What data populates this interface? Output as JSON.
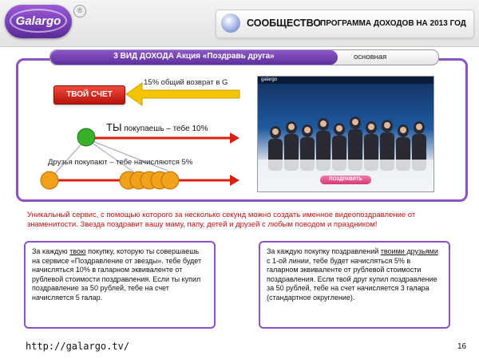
{
  "header": {
    "logo_text": "Galargo",
    "logo_mark": "®",
    "title_main": "СООБЩЕСТВО",
    "title_sub": "ПРОГРАММА ДОХОДОВ НА 2013 ГОД"
  },
  "banner": {
    "title": "3 ВИД ДОХОДА  Акция «Поздравь  друга»",
    "note": "основная"
  },
  "diagram": {
    "account_label": "ТВОЙ СЧЕТ",
    "return_label": "15% общий возврат  в G",
    "you_big": "ТЫ",
    "you_rest": " покупаешь – тебе 10%",
    "friends_label": "Друзья покупают – тебе начисляются 5%",
    "colors": {
      "arrow_red": "#d81f12",
      "arrow_yellow": "#f4c400",
      "dot_green": "#3ab02a",
      "dot_orange": "#f2a21a"
    }
  },
  "video": {
    "site_logo": "galargo",
    "button_label": "ПОЗДРАВИТЬ"
  },
  "red_paragraph": "Уникальный сервис, с помощью которого за несколько секунд можно создать именное видеопоздравление от знаменитости. Звезда поздравит вашу маму, папу, детей и друзей с любым поводом и праздником!",
  "box_left": {
    "p1": "За каждую ",
    "u1": "твою",
    "p2": " покупку, которую ты совершаешь на  сервисе «Поздравление от звезды». тебе будет начисляться 10% в галарном эквиваленте от рублевой стоимости поздравления. Если ты купил поздравление за 50 рублей, тебе на счет начисляется 5 галар."
  },
  "box_right": {
    "p1": "За каждую покупку поздравлений ",
    "u1": "твоими друзьями",
    "p2": " с 1-ой линии, тебе будет начисляться 5% в галарном эквиваленте от рублевой стоимости поздравления. Если твой друг купил поздравление за 50 рублей, тебе на счет начисляется 3 галара (стандартное округление)."
  },
  "footer": {
    "url": "http://galargo.tv/",
    "page": "16"
  }
}
